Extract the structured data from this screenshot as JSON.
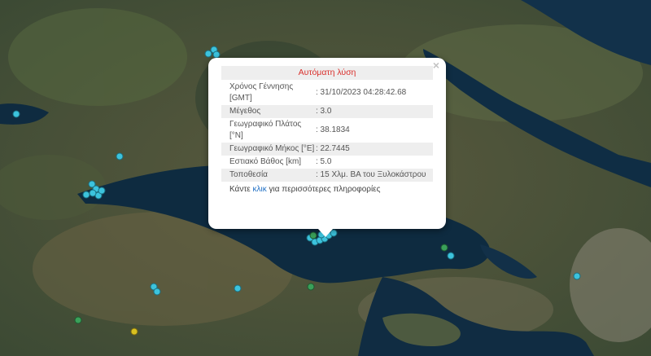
{
  "popup": {
    "title": "Αυτόματη λύση",
    "close_symbol": "×",
    "rows": [
      {
        "label": "Χρόνος Γέννησης [GMT]",
        "value": ": 31/10/2023 04:28:42.68"
      },
      {
        "label": "Μέγεθος",
        "value": ": 3.0"
      },
      {
        "label": "Γεωγραφικό Πλάτος [°N]",
        "value": ": 38.1834"
      },
      {
        "label": "Γεωγραφικό Μήκος [°E]",
        "value": ": 22.7445"
      },
      {
        "label": "Εστιακό Βάθος [km]",
        "value": ": 5.0"
      },
      {
        "label": "Τοποθεσία",
        "value": ": 15 Χλμ. ΒΑ του Ξυλοκάστρου"
      }
    ],
    "more_prefix": "Κάντε ",
    "more_link": "κλικ",
    "more_suffix": " για περισσότερες πληροφορίες"
  },
  "colors": {
    "marker_cyan": "#3cc3dd",
    "marker_green": "#3aa05a",
    "marker_yellow": "#d8c020",
    "sea": "#0d2a40",
    "land": "#4a5a3c"
  }
}
